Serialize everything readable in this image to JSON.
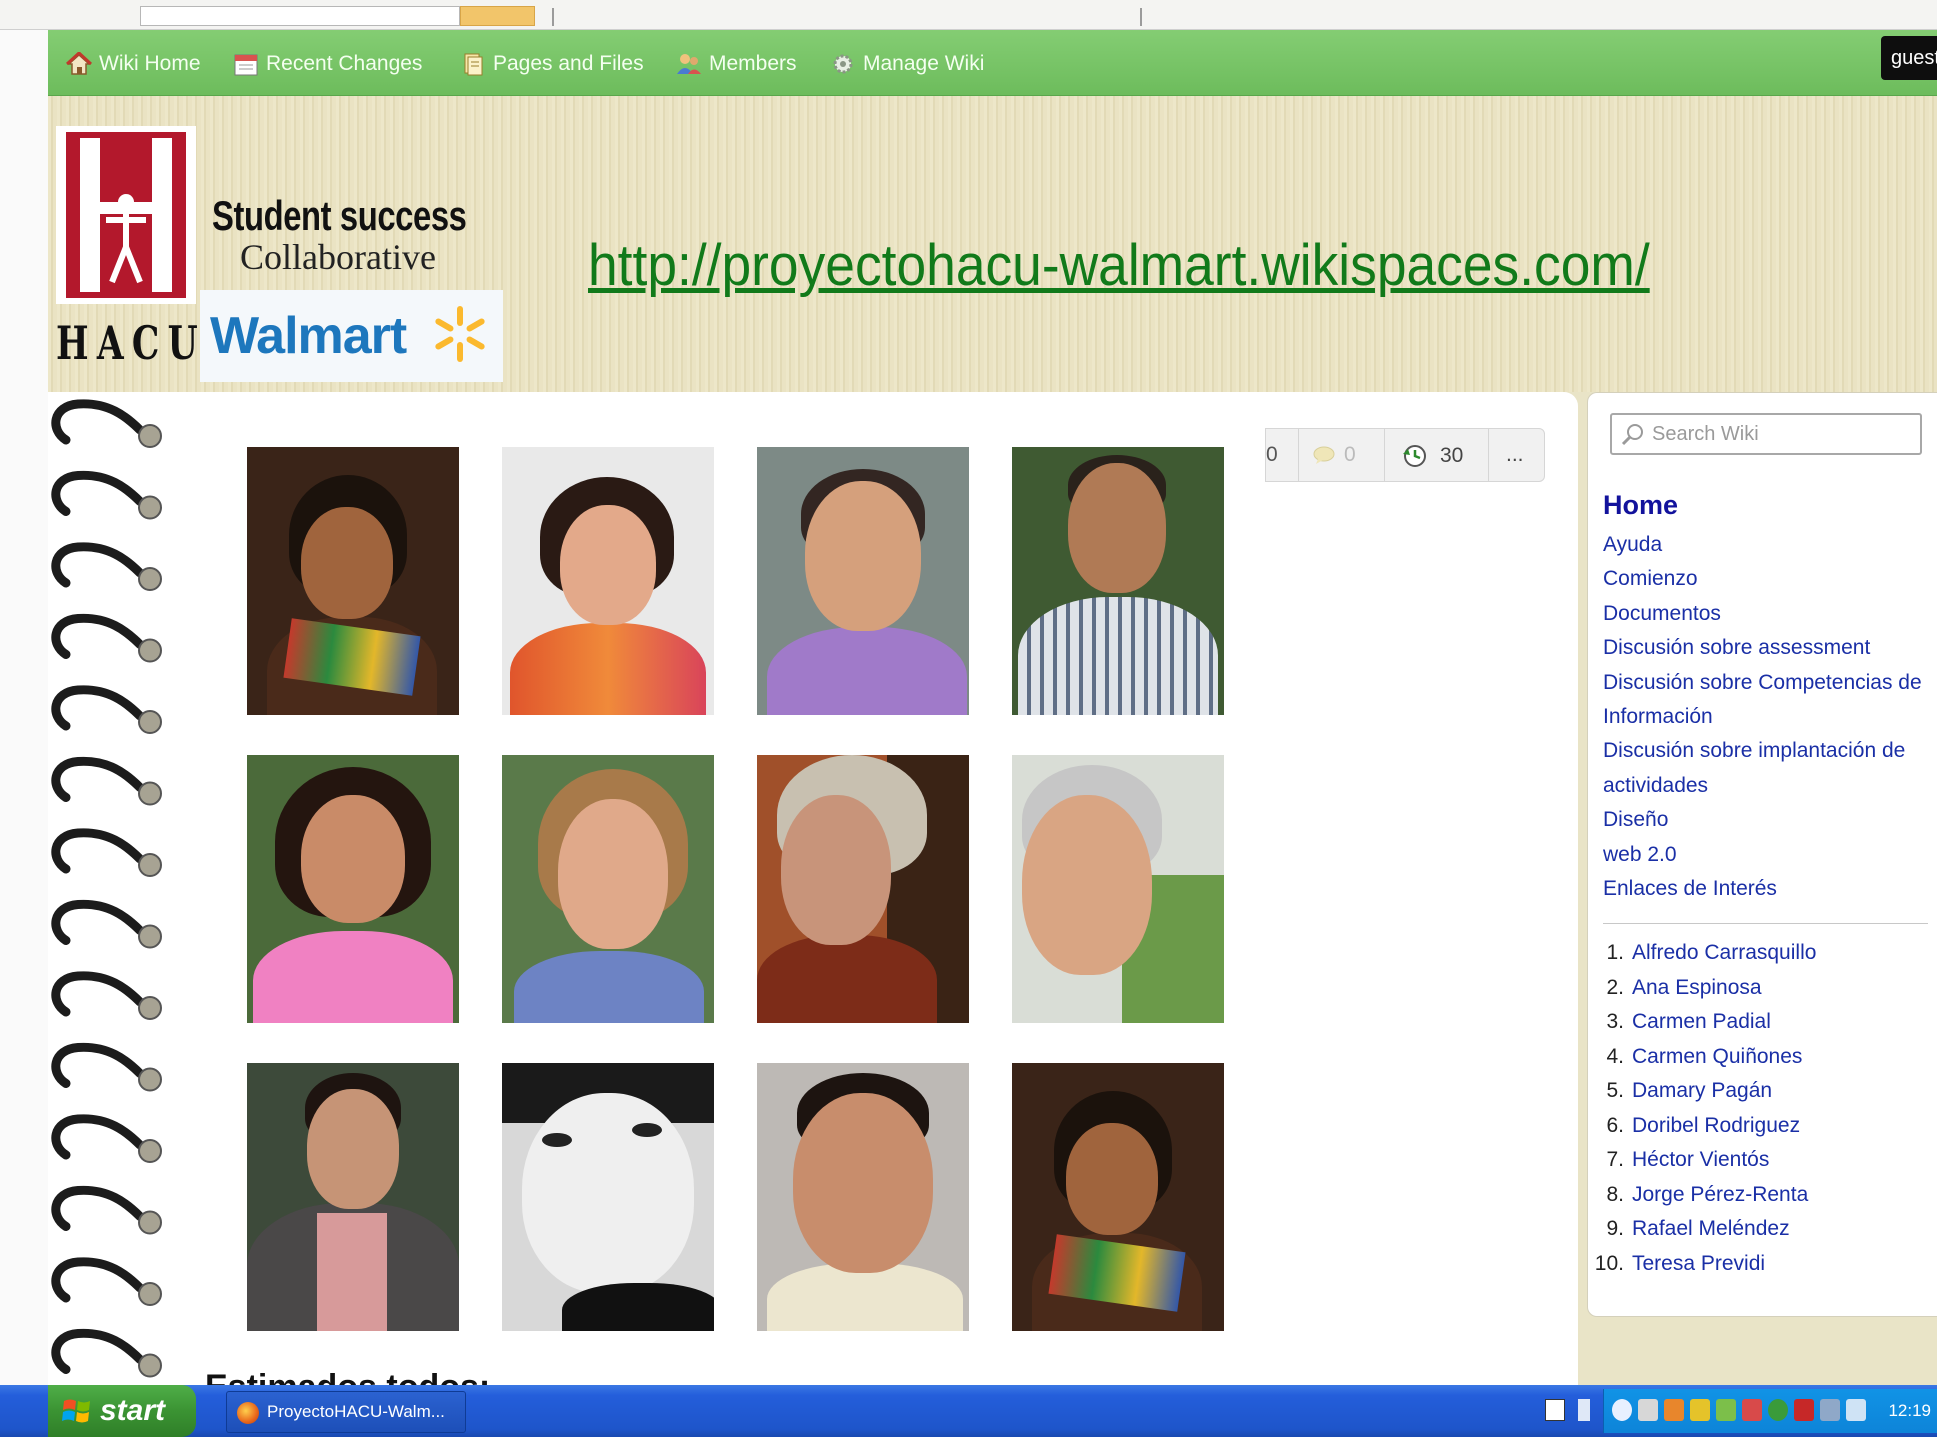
{
  "nav": {
    "items": [
      {
        "label": "Wiki Home",
        "icon": "home-icon"
      },
      {
        "label": "Recent Changes",
        "icon": "calendar-icon"
      },
      {
        "label": "Pages and Files",
        "icon": "files-icon"
      },
      {
        "label": "Members",
        "icon": "members-icon"
      },
      {
        "label": "Manage Wiki",
        "icon": "gear-icon"
      }
    ],
    "user_badge": "guest"
  },
  "banner": {
    "hacu_letters": "HACU",
    "title": "Student success",
    "subtitle": "Collaborative",
    "walmart": "Walmart",
    "url": "http://proyectohacu-walmart.wikispaces.com/"
  },
  "page_stats": {
    "first_count": "0",
    "comments": "0",
    "revisions": "30",
    "more": "..."
  },
  "main": {
    "cut_heading": "Estimados todos:"
  },
  "sidebar": {
    "search_placeholder": "Search Wiki",
    "home": "Home",
    "links": [
      "Ayuda",
      "Comienzo",
      "Documentos",
      "Discusión sobre assessment",
      "Discusión sobre Competencias de",
      "Información",
      "Discusión sobre implantación de",
      "actividades",
      "Diseño",
      "web 2.0",
      "Enlaces de Interés"
    ],
    "members": [
      {
        "num": "1.",
        "name": "Alfredo Carrasquillo"
      },
      {
        "num": "2.",
        "name": "Ana Espinosa"
      },
      {
        "num": "3.",
        "name": "Carmen Padial"
      },
      {
        "num": "4.",
        "name": "Carmen Quiñones"
      },
      {
        "num": "5.",
        "name": "Damary Pagán"
      },
      {
        "num": "6.",
        "name": "Doribel Rodriguez"
      },
      {
        "num": "7.",
        "name": "Héctor Vientós"
      },
      {
        "num": "8.",
        "name": "Jorge Pérez-Renta"
      },
      {
        "num": "9.",
        "name": "Rafael Meléndez"
      },
      {
        "num": "10.",
        "name": "Teresa Previdi"
      }
    ]
  },
  "taskbar": {
    "start": "start",
    "window_title": "ProyectoHACU-Walm...",
    "clock": "12:19"
  },
  "colors": {
    "nav_green": "#6dbc5c",
    "link_blue": "#1a2fa6",
    "url_green": "#117a1a",
    "hacu_red": "#b3182c",
    "walmart_blue": "#1d77bd"
  }
}
